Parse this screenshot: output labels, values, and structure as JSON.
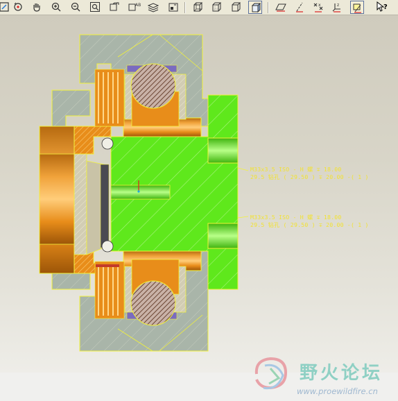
{
  "toolbar": {
    "buttons": [
      {
        "name": "repaint-icon"
      },
      {
        "name": "spin-center-icon"
      },
      {
        "name": "pan-hand-icon"
      },
      {
        "name": "zoom-in-icon"
      },
      {
        "name": "zoom-out-icon"
      },
      {
        "name": "refit-icon"
      },
      {
        "name": "reorient-icon"
      },
      {
        "name": "layers-icon"
      },
      {
        "name": "model-tree-icon"
      },
      {
        "name": "wireframe-icon"
      },
      {
        "name": "hidden-line-icon"
      },
      {
        "name": "no-hidden-icon"
      },
      {
        "name": "shading-icon"
      },
      {
        "name": "datum-planes-icon"
      },
      {
        "name": "datum-axes-icon"
      },
      {
        "name": "datum-points-icon"
      },
      {
        "name": "coordinate-systems-icon"
      },
      {
        "name": "annotation-display-icon"
      },
      {
        "name": "context-help-icon"
      }
    ],
    "help_glyph": "?"
  },
  "annotations": {
    "hole_1_line1": "M33x3.5 ISO - H 螺 ∓ 18.00",
    "hole_1_line2": "29.5 钻孔 ( 29.50 ) ∓ 20.00  -( 1 )",
    "hole_2_line1": "M33x3.5 ISO - H 螺 ∓ 18.00",
    "hole_2_line2": "29.5 钻孔 ( 29.50 ) ∓ 20.00  -( 1 )"
  },
  "watermark": {
    "title": "野火论坛",
    "url": "www.proewildfire.cn"
  },
  "colors": {
    "part_green": "#5fe81c",
    "bearing_orange": "#e88d1a",
    "housing_gray": "#a9b5a9",
    "edge_yellow": "#f2f23a",
    "ball_brown": "#b07a6a",
    "seal_purple": "#7a6bc0"
  }
}
